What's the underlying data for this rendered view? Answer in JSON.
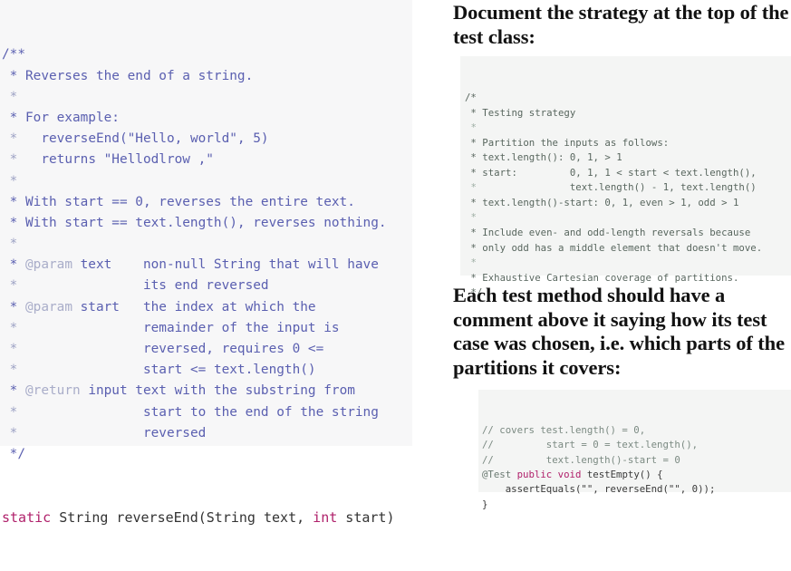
{
  "left": {
    "spec_code": {
      "lines": [
        [
          {
            "t": "/**",
            "c": "cmt"
          }
        ],
        [
          {
            "t": " * Reverses the end of a string.",
            "c": "cmt"
          }
        ],
        [
          {
            "t": " ",
            "c": "cmt"
          },
          {
            "t": "*",
            "c": "star"
          }
        ],
        [
          {
            "t": " * For example:",
            "c": "cmt"
          }
        ],
        [
          {
            "t": " ",
            "c": "cmt"
          },
          {
            "t": "*",
            "c": "star"
          },
          {
            "t": "   reverseEnd(\"Hello, world\", 5)",
            "c": "cmt"
          }
        ],
        [
          {
            "t": " ",
            "c": "cmt"
          },
          {
            "t": "*",
            "c": "star"
          },
          {
            "t": "   returns \"Hellodlrow ,\"",
            "c": "cmt"
          }
        ],
        [
          {
            "t": " ",
            "c": "cmt"
          },
          {
            "t": "*",
            "c": "star"
          }
        ],
        [
          {
            "t": " * With start == 0, reverses the entire text.",
            "c": "cmt"
          }
        ],
        [
          {
            "t": " * With start == text.length(), reverses nothing.",
            "c": "cmt"
          }
        ],
        [
          {
            "t": " ",
            "c": "cmt"
          },
          {
            "t": "*",
            "c": "star"
          }
        ],
        [
          {
            "t": " * ",
            "c": "cmt"
          },
          {
            "t": "@param",
            "c": "tag"
          },
          {
            "t": " text    non-null String that will have",
            "c": "cmt"
          }
        ],
        [
          {
            "t": " ",
            "c": "cmt"
          },
          {
            "t": "*",
            "c": "star"
          },
          {
            "t": "                its end reversed",
            "c": "cmt"
          }
        ],
        [
          {
            "t": " * ",
            "c": "cmt"
          },
          {
            "t": "@param",
            "c": "tag"
          },
          {
            "t": " start   the index at which the",
            "c": "cmt"
          }
        ],
        [
          {
            "t": " ",
            "c": "cmt"
          },
          {
            "t": "*",
            "c": "star"
          },
          {
            "t": "                remainder of the input is",
            "c": "cmt"
          }
        ],
        [
          {
            "t": " ",
            "c": "cmt"
          },
          {
            "t": "*",
            "c": "star"
          },
          {
            "t": "                reversed, requires 0 <=",
            "c": "cmt"
          }
        ],
        [
          {
            "t": " ",
            "c": "cmt"
          },
          {
            "t": "*",
            "c": "star"
          },
          {
            "t": "                start <= text.length()",
            "c": "cmt"
          }
        ],
        [
          {
            "t": " * ",
            "c": "cmt"
          },
          {
            "t": "@return",
            "c": "tag"
          },
          {
            "t": " input text with the substring from",
            "c": "cmt"
          }
        ],
        [
          {
            "t": " ",
            "c": "cmt"
          },
          {
            "t": "*",
            "c": "star"
          },
          {
            "t": "                start to the end of the string",
            "c": "cmt"
          }
        ],
        [
          {
            "t": " ",
            "c": "cmt"
          },
          {
            "t": "*",
            "c": "star"
          },
          {
            "t": "                reversed",
            "c": "cmt"
          }
        ],
        [
          {
            "t": " */",
            "c": "cmt"
          }
        ]
      ],
      "signature": [
        {
          "t": "static",
          "c": "kw"
        },
        {
          "t": " String reverseEnd(String text, ",
          "c": "sig"
        },
        {
          "t": "int",
          "c": "kw"
        },
        {
          "t": " start)",
          "c": "sig"
        }
      ]
    }
  },
  "right": {
    "heading_strategy": "Document the strategy at the top of the test class:",
    "strategy_code": {
      "lines": [
        [
          {
            "t": "/*",
            "c": ""
          }
        ],
        [
          {
            "t": " * Testing strategy",
            "c": ""
          }
        ],
        [
          {
            "t": " ",
            "c": ""
          },
          {
            "t": "*",
            "c": "star"
          }
        ],
        [
          {
            "t": " * Partition the inputs as follows:",
            "c": ""
          }
        ],
        [
          {
            "t": " * text.length(): 0, 1, > 1",
            "c": ""
          }
        ],
        [
          {
            "t": " * start:         0, 1, 1 < start < text.length(),",
            "c": ""
          }
        ],
        [
          {
            "t": " ",
            "c": ""
          },
          {
            "t": "*",
            "c": "star"
          },
          {
            "t": "                text.length() - 1, text.length()",
            "c": ""
          }
        ],
        [
          {
            "t": " * text.length()-start: 0, 1, even > 1, odd > 1",
            "c": ""
          }
        ],
        [
          {
            "t": " ",
            "c": ""
          },
          {
            "t": "*",
            "c": "star"
          }
        ],
        [
          {
            "t": " * Include even- and odd-length reversals because",
            "c": ""
          }
        ],
        [
          {
            "t": " * only odd has a middle element that doesn't move.",
            "c": ""
          }
        ],
        [
          {
            "t": " ",
            "c": ""
          },
          {
            "t": "*",
            "c": "star"
          }
        ],
        [
          {
            "t": " * Exhaustive Cartesian coverage of partitions.",
            "c": ""
          }
        ],
        [
          {
            "t": " */",
            "c": ""
          }
        ]
      ]
    },
    "heading_testmethod": "Each test method should have a comment above it saying how its test case was chosen, i.e. which parts of the partitions it covers:",
    "test_code": {
      "lines": [
        [
          {
            "t": "// covers test.length() = 0,",
            "c": "cmt"
          }
        ],
        [
          {
            "t": "//         start = 0 = text.length(),",
            "c": "cmt"
          }
        ],
        [
          {
            "t": "//         text.length()-start = 0",
            "c": "cmt"
          }
        ],
        [
          {
            "t": "@Test",
            "c": "anno"
          },
          {
            "t": " ",
            "c": "plain"
          },
          {
            "t": "public",
            "c": "kw"
          },
          {
            "t": " ",
            "c": "plain"
          },
          {
            "t": "void",
            "c": "kw"
          },
          {
            "t": " testEmpty() {",
            "c": "plain"
          }
        ],
        [
          {
            "t": "    assertEquals(\"\", reverseEnd(\"\", 0));",
            "c": "plain"
          }
        ],
        [
          {
            "t": "}",
            "c": "plain"
          }
        ]
      ]
    }
  },
  "colors": {
    "code_bg_left": "#f7f7f8",
    "code_bg_right": "#f4f5f4",
    "javadoc_text": "#5a5fb0",
    "javadoc_tag": "#a9adc9",
    "keyword": "#b0216b",
    "comment_green": "#58665e",
    "heading": "#121212"
  }
}
